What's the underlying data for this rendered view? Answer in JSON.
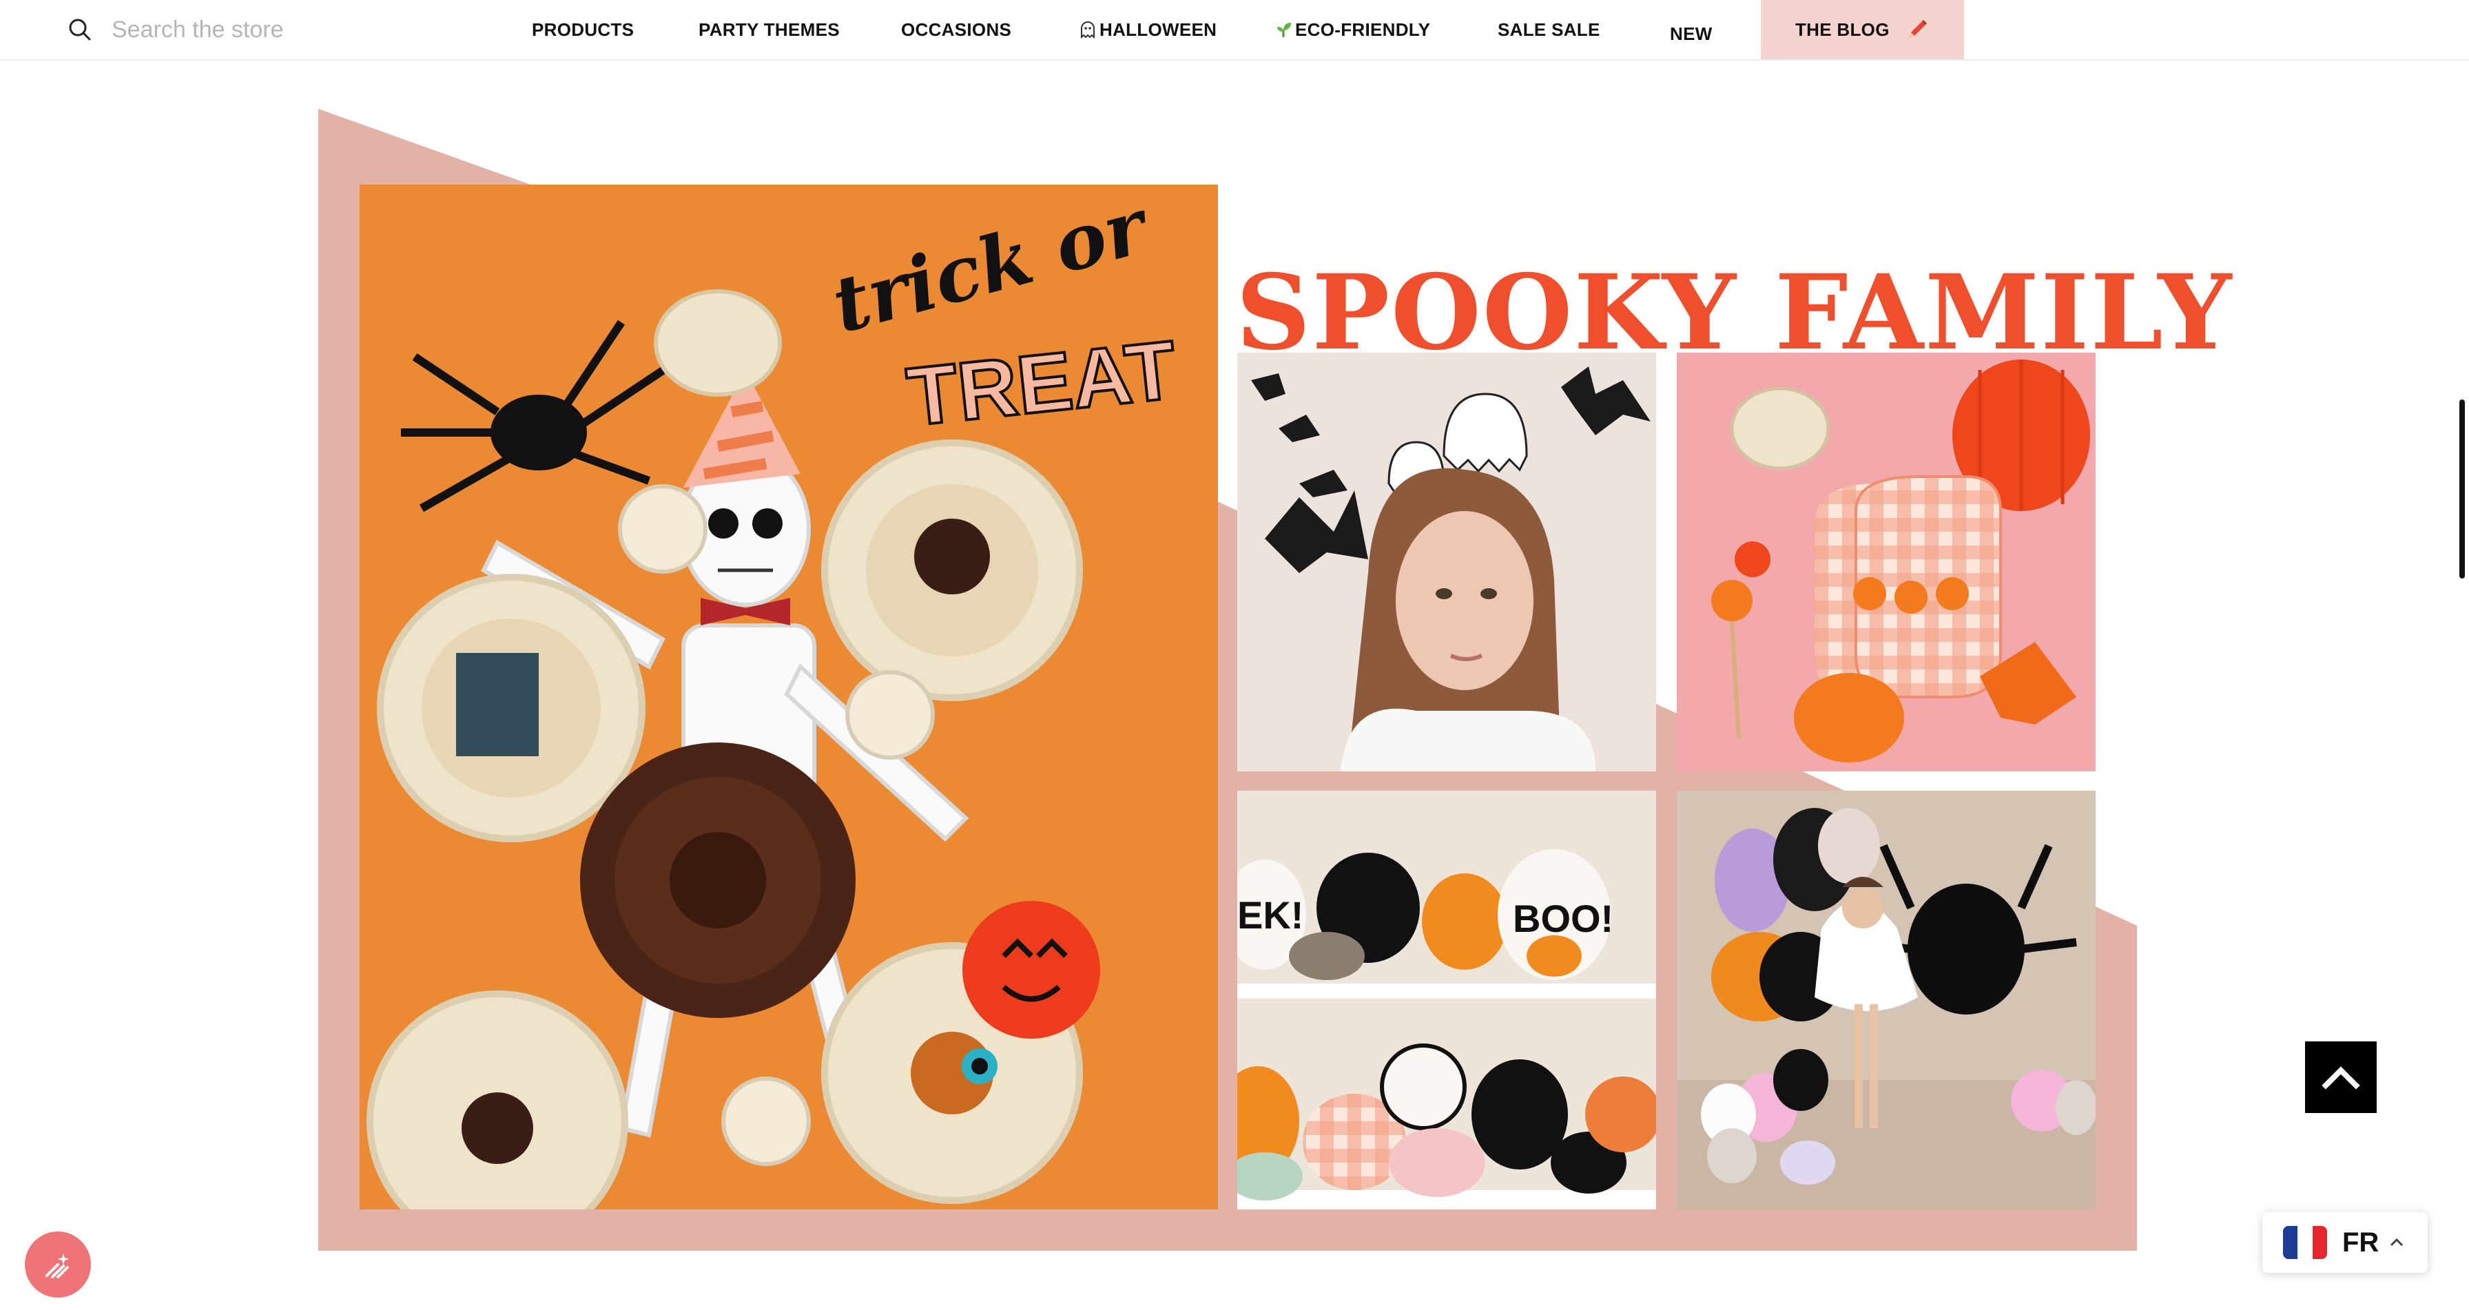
{
  "search": {
    "placeholder": "Search the store"
  },
  "nav": {
    "items": [
      {
        "label": "PRODUCTS"
      },
      {
        "label": "PARTY THEMES"
      },
      {
        "label": "OCCASIONS"
      },
      {
        "label": "HALLOWEEN",
        "icon": "ghost-icon"
      },
      {
        "label": "ECO-FRIENDLY",
        "icon": "sprout-icon"
      },
      {
        "label": "SALE SALE"
      },
      {
        "label": "NEW"
      },
      {
        "label": "THE BLOG",
        "icon": "pencil-icon"
      }
    ]
  },
  "hero": {
    "title": "SPOOKY FAMILY",
    "main_photo_text": {
      "line1": "trick or",
      "line2": "TREAT"
    },
    "shelf_text": {
      "left": "EK!",
      "right": "BOO!"
    }
  },
  "language": {
    "code": "FR"
  },
  "colors": {
    "accent": "#ef4f2d",
    "frame": "#e2b2a7",
    "blog_highlight": "#f5d3cf",
    "orange_photo": "#ef8f3a",
    "pink_photo": "#f3a8ac"
  }
}
